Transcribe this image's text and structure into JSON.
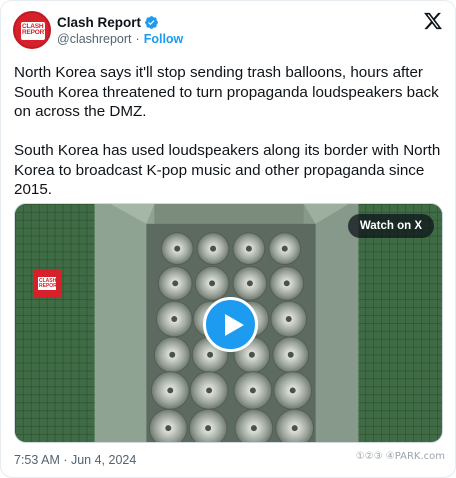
{
  "author": {
    "name": "Clash Report",
    "handle": "@clashreport",
    "separator": "·",
    "follow_label": "Follow",
    "avatar_text": "CLASH REPORT",
    "verified_color": "#1d9bf0",
    "brand_color": "#d6202a"
  },
  "tweet": {
    "paragraph_1": "North Korea says it'll stop sending trash balloons, hours after South Korea threatened to turn propaganda loudspeakers back on across the DMZ.",
    "paragraph_2": "South Korea has used loudspeakers along its border with North Korea to broadcast K-pop music and other propaganda since 2015."
  },
  "media": {
    "watch_label": "Watch on X",
    "play_icon": "play-icon",
    "watermark_text": "CLASH REPORT"
  },
  "footer": {
    "timestamp": "7:53 AM · Jun 4, 2024",
    "site_watermark": "①②③ ④PARK.com"
  },
  "icons": {
    "x_logo": "x-logo-icon",
    "verified": "verified-badge-icon"
  }
}
